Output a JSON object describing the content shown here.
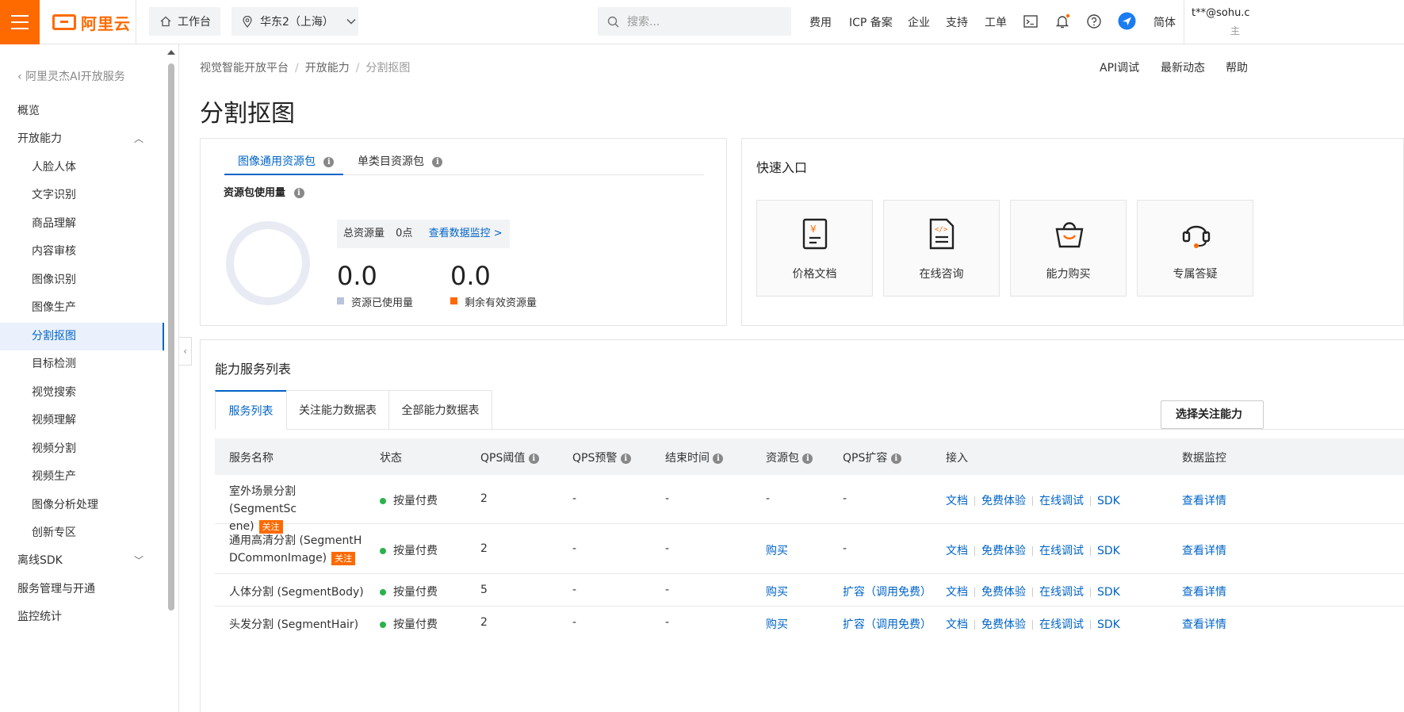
{
  "topbar": {
    "logo_text": "阿里云",
    "workbench": "工作台",
    "region": "华东2（上海）",
    "search_placeholder": "搜索...",
    "nav": [
      "费用",
      "ICP 备案",
      "企业",
      "支持",
      "工单"
    ],
    "lang": "简体",
    "user": "t**@sohu.c",
    "user_sub": "主"
  },
  "sidebar": {
    "back": "阿里灵杰AI开放服务",
    "items": [
      {
        "label": "概览"
      },
      {
        "label": "开放能力"
      },
      {
        "label": "人脸人体"
      },
      {
        "label": "文字识别"
      },
      {
        "label": "商品理解"
      },
      {
        "label": "内容审核"
      },
      {
        "label": "图像识别"
      },
      {
        "label": "图像生产"
      },
      {
        "label": "分割抠图"
      },
      {
        "label": "目标检测"
      },
      {
        "label": "视觉搜索"
      },
      {
        "label": "视频理解"
      },
      {
        "label": "视频分割"
      },
      {
        "label": "视频生产"
      },
      {
        "label": "图像分析处理"
      },
      {
        "label": "创新专区"
      },
      {
        "label": "离线SDK"
      },
      {
        "label": "服务管理与开通"
      },
      {
        "label": "监控统计"
      }
    ]
  },
  "breadcrumb": [
    "视觉智能开放平台",
    "开放能力",
    "分割抠图"
  ],
  "top_links": [
    "API调试",
    "最新动态",
    "帮助"
  ],
  "page_title": "分割抠图",
  "resource": {
    "tabs": [
      "图像通用资源包",
      "单类目资源包"
    ],
    "usage_title": "资源包使用量",
    "total_label": "总资源量",
    "total_value": "0点",
    "monitor_link": "查看数据监控 >",
    "used_value": "0.0",
    "used_label": "资源已使用量",
    "remain_value": "0.0",
    "remain_label": "剩余有效资源量",
    "colors": {
      "used": "#b9c3dd",
      "remain": "#ff6a00"
    }
  },
  "quick": {
    "title": "快速入口",
    "tiles": [
      {
        "label": "价格文档",
        "icon": "price-doc-icon"
      },
      {
        "label": "在线咨询",
        "icon": "online-consult-icon"
      },
      {
        "label": "能力购买",
        "icon": "shopping-bag-icon"
      },
      {
        "label": "专属答疑",
        "icon": "headset-icon"
      }
    ]
  },
  "services": {
    "title": "能力服务列表",
    "tabs": [
      "服务列表",
      "关注能力数据表",
      "全部能力数据表"
    ],
    "select_button": "选择关注能力",
    "columns": [
      "服务名称",
      "状态",
      "QPS阈值",
      "QPS预警",
      "结束时间",
      "资源包",
      "QPS扩容",
      "接入",
      "数据监控"
    ],
    "rows": [
      {
        "name1": "室外场景分割 (SegmentSc",
        "name2": "ene)",
        "tag": "关注",
        "status": "按量付费",
        "qps": "2",
        "warn": "-",
        "end": "-",
        "pack": "-",
        "expand": "-",
        "links": [
          "文档",
          "免费体验",
          "在线调试",
          "SDK"
        ],
        "monitor": "查看详情"
      },
      {
        "name1": "通用高清分割 (SegmentH",
        "name2": "DCommonImage)",
        "tag": "关注",
        "status": "按量付费",
        "qps": "2",
        "warn": "-",
        "end": "-",
        "pack": "购买",
        "expand": "-",
        "links": [
          "文档",
          "免费体验",
          "在线调试",
          "SDK"
        ],
        "monitor": "查看详情"
      },
      {
        "name1": "人体分割 (SegmentBody)",
        "status": "按量付费",
        "qps": "5",
        "warn": "-",
        "end": "-",
        "pack": "购买",
        "expand": "扩容（调用免费）",
        "links": [
          "文档",
          "免费体验",
          "在线调试",
          "SDK"
        ],
        "monitor": "查看详情"
      },
      {
        "name1": "头发分割 (SegmentHair)",
        "status": "按量付费",
        "qps": "2",
        "warn": "-",
        "end": "-",
        "pack": "购买",
        "expand": "扩容（调用免费）",
        "links": [
          "文档",
          "免费体验",
          "在线调试",
          "SDK"
        ],
        "monitor": "查看详情"
      }
    ]
  }
}
